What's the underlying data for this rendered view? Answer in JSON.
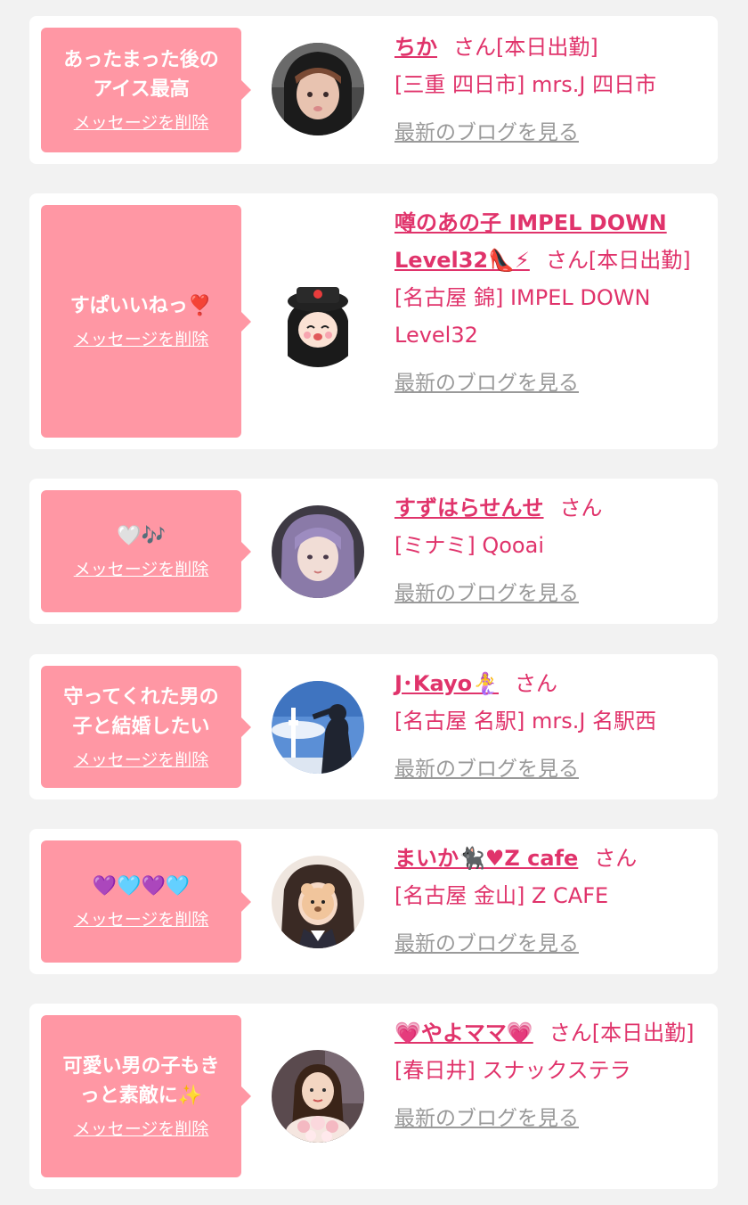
{
  "delete_label": "メッセージを削除",
  "blog_label": "最新のブログを見る",
  "colors": {
    "bubble": "#ff97a4",
    "link": "#e0336b",
    "muted": "#9a9a9a",
    "background": "#f2f2f2"
  },
  "items": [
    {
      "message": "あったまった後の\nアイス最高",
      "name": "ちか",
      "suffix": "さん[本日出勤]",
      "shop": "[三重 四日市] mrs.J 四日市"
    },
    {
      "message": "すぱいいねっ❣️",
      "name": "噂のあの子 IMPEL DOWN Level32👠⚡",
      "suffix": "さん[本日出勤]",
      "shop": "[名古屋 錦] IMPEL DOWN Level32"
    },
    {
      "message": "🤍🎶",
      "name": "すずはらせんせ",
      "suffix": "さん",
      "shop": "[ミナミ] Qooai"
    },
    {
      "message": "守ってくれた男の\n子と結婚したい",
      "name": "J･Kayo🧜‍♀️",
      "suffix": "さん",
      "shop": "[名古屋 名駅] mrs.J 名駅西"
    },
    {
      "message": "💜🩵💜🩵",
      "name": "まいか🐈‍⬛♥Z cafe",
      "suffix": "さん",
      "shop": "[名古屋 金山] Z CAFE"
    },
    {
      "message": "可愛い男の子もき\nっと素敵に✨",
      "name": "💗やよママ💗",
      "suffix": "さん[本日出勤]",
      "shop": "[春日井] スナックステラ"
    }
  ]
}
